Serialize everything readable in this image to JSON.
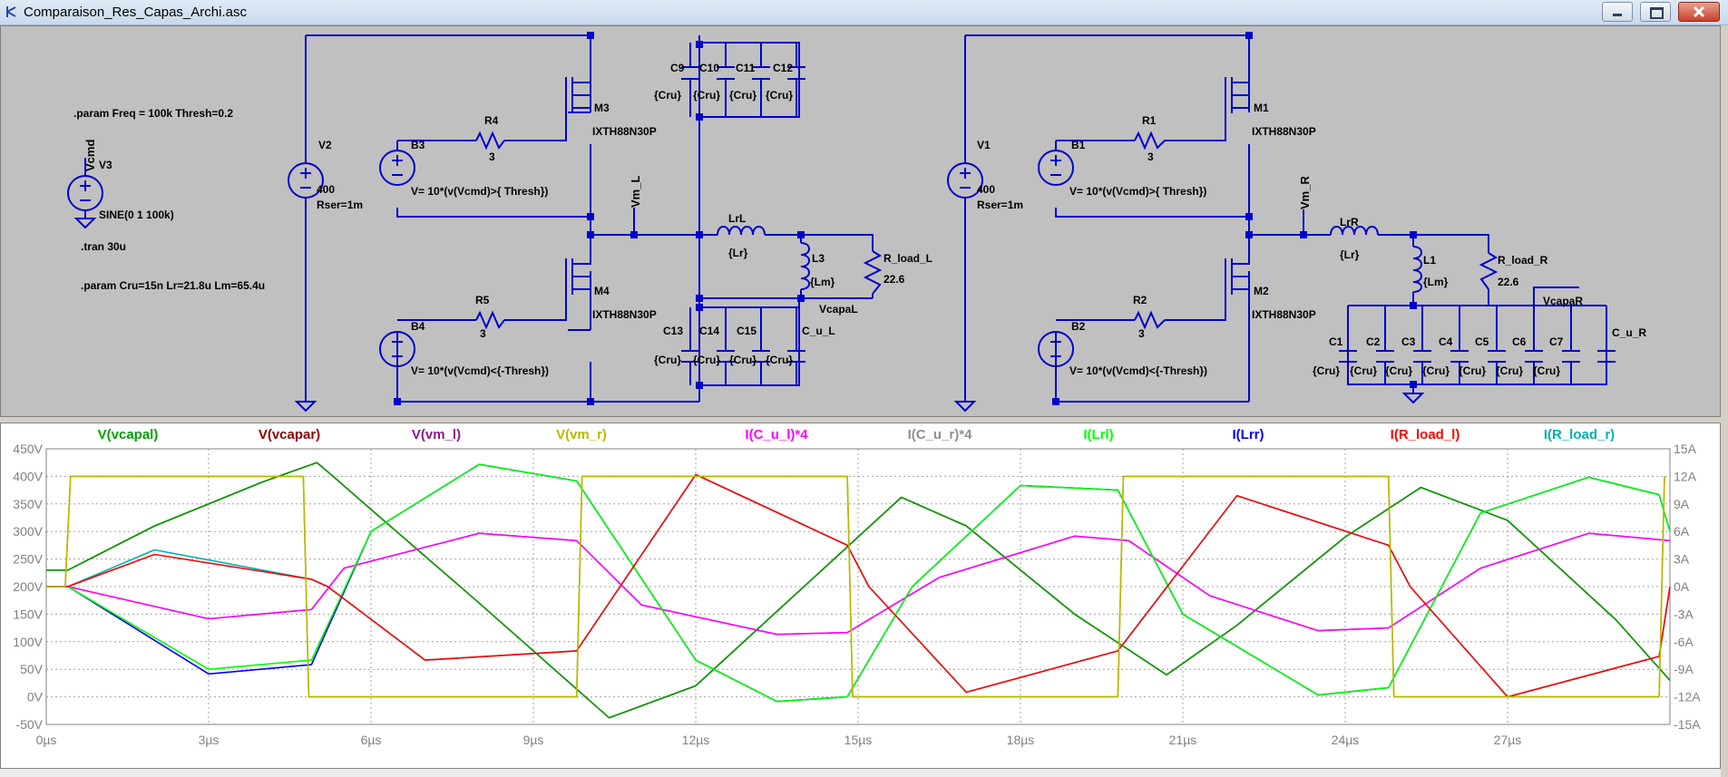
{
  "window": {
    "title": "Comparaison_Res_Capas_Archi.asc",
    "buttons": [
      "minimize",
      "maximize",
      "close"
    ]
  },
  "schematic": {
    "directives": [
      ".param Freq = 100k Thresh=0.2",
      ".tran 30u",
      ".param Cru=15n Lr=21.8u Lm=65.4u"
    ],
    "sources": {
      "v3_name": "V3",
      "v3_value": "SINE(0 1 100k)",
      "v3_net": "Vcmd",
      "v2_name": "V2",
      "v2_value": "400",
      "v2_rser": "Rser=1m",
      "v1_name": "V1",
      "v1_value": "400",
      "v1_rser": "Rser=1m",
      "b3_name": "B3",
      "b3_expr": "V= 10*(v(Vcmd)>{ Thresh})",
      "b4_name": "B4",
      "b4_expr": "V= 10*(v(Vcmd)<{-Thresh})",
      "b1_name": "B1",
      "b1_expr": "V= 10*(v(Vcmd)>{ Thresh})",
      "b2_name": "B2",
      "b2_expr": "V= 10*(v(Vcmd)<{-Thresh})"
    },
    "resistors": {
      "r4_name": "R4",
      "r4_value": "3",
      "r5_name": "R5",
      "r5_value": "3",
      "r1_name": "R1",
      "r1_value": "3",
      "r2_name": "R2",
      "r2_value": "3",
      "rl_name": "R_load_L",
      "rl_value": "22.6",
      "rr_name": "R_load_R",
      "rr_value": "22.6"
    },
    "mosfets": {
      "m3": "M3",
      "m4": "M4",
      "m1": "M1",
      "m2": "M2",
      "part": "IXTH88N30P"
    },
    "inductors": {
      "lrl_name": "LrL",
      "lrl_value": "{Lr}",
      "l3_name": "L3",
      "l3_value": "{Lm}",
      "lrr_name": "LrR",
      "lrr_value": "{Lr}",
      "l1_name": "L1",
      "l1_value": "{Lm}"
    },
    "capacitors": {
      "left_top": [
        "C9",
        "C10",
        "C11",
        "C12"
      ],
      "left_bottom": [
        "C13",
        "C14",
        "C15"
      ],
      "left_bottom_extra": "C_u_L",
      "right_bottom": [
        "C1",
        "C2",
        "C3",
        "C4",
        "C5",
        "C6",
        "C7"
      ],
      "right_bottom_extra": "C_u_R",
      "value": "{Cru}"
    },
    "nets": {
      "vm_l": "Vm_L",
      "vm_r": "Vm_R",
      "vcapa_l": "VcapaL",
      "vcapa_r": "VcapaR"
    }
  },
  "plot": {
    "colors": {
      "vcapal": "#00a000",
      "vcapar": "#900000",
      "vm_l": "#8a1a8a",
      "vm_r": "#b8b800",
      "i_cul": "#ff00ff",
      "i_cur": "#909090",
      "i_lrl": "#00ff00",
      "i_lrr": "#0000ff",
      "i_rll": "#ff0000",
      "i_rlr": "#00b0b0"
    },
    "legend": [
      "V(vcapal)",
      "V(vcapar)",
      "V(vm_l)",
      "V(vm_r)",
      "I(C_u_l)*4",
      "I(C_u_r)*4",
      "I(Lrl)",
      "I(Lrr)",
      "I(R_load_l)",
      "I(R_load_r)"
    ],
    "y_left_ticks": [
      "450V",
      "400V",
      "350V",
      "300V",
      "250V",
      "200V",
      "150V",
      "100V",
      "50V",
      "0V",
      "-50V"
    ],
    "y_right_ticks": [
      "15A",
      "12A",
      "9A",
      "6A",
      "3A",
      "0A",
      "-3A",
      "-6A",
      "-9A",
      "-12A",
      "-15A"
    ],
    "x_ticks": [
      "0µs",
      "3µs",
      "6µs",
      "9µs",
      "12µs",
      "15µs",
      "18µs",
      "21µs",
      "24µs",
      "27µs"
    ]
  },
  "chart_data": {
    "type": "line",
    "xlabel": "",
    "x_unit": "µs",
    "xlim": [
      0,
      30
    ],
    "ylim_left": [
      -50,
      450
    ],
    "ylim_right": [
      -15,
      15
    ],
    "series": [
      {
        "name": "V(vm_r)",
        "x": [
          0,
          0.35,
          0.45,
          4.75,
          4.85,
          5.3,
          9.8,
          9.9,
          14.8,
          14.9,
          19.8,
          19.9,
          24.8,
          24.9,
          29.8,
          29.9
        ],
        "values": [
          200,
          200,
          400,
          400,
          0,
          0,
          0,
          400,
          400,
          0,
          0,
          400,
          400,
          0,
          0,
          400
        ]
      },
      {
        "name": "V(vcapar)",
        "x": [
          0,
          0.4,
          2,
          4,
          5,
          5.3,
          6,
          8,
          10.4,
          12,
          14,
          15.8,
          17,
          19,
          20.7,
          22,
          24,
          25.4,
          27,
          29,
          30
        ],
        "values": [
          230,
          230,
          310,
          390,
          425,
          400,
          340,
          170,
          -38,
          20,
          200,
          362,
          310,
          150,
          40,
          130,
          290,
          380,
          320,
          140,
          30
        ]
      },
      {
        "name": "V(vcapal)",
        "x": [
          0,
          0.4,
          2,
          4,
          5,
          5.3,
          6,
          8,
          10.4,
          12,
          14,
          15.8,
          17,
          19,
          20.7,
          22,
          24,
          25.4,
          27,
          29,
          30
        ],
        "values": [
          230,
          230,
          310,
          390,
          425,
          400,
          340,
          170,
          -38,
          20,
          200,
          362,
          310,
          150,
          40,
          130,
          290,
          380,
          320,
          140,
          30
        ]
      },
      {
        "name": "I(Lrr)",
        "x": [
          0,
          0.4,
          3,
          4.9,
          6,
          8,
          9.8,
          12,
          13.5,
          14.8,
          16,
          18,
          19.8,
          21,
          23.5,
          24.8,
          26.5,
          28.5,
          29.8,
          30
        ],
        "values": [
          0,
          0,
          -9.5,
          -8.5,
          6,
          13.3,
          11.5,
          -8,
          -12.5,
          -12,
          0,
          11,
          10.5,
          -3,
          -11.8,
          -11,
          8,
          11.9,
          10,
          6
        ]
      },
      {
        "name": "I(R_load_r)",
        "x": [
          0,
          0.4,
          2,
          4.9,
          5.2,
          7,
          9.8,
          12,
          14.8,
          15.2,
          17,
          19.8,
          22,
          24.8,
          25.2,
          27,
          29.8,
          30
        ],
        "values": [
          0,
          0,
          4,
          0.8,
          0,
          -8,
          -7,
          12.2,
          4.5,
          0,
          -11.5,
          -7,
          9.9,
          4.5,
          0,
          -12,
          -7.6,
          0
        ]
      },
      {
        "name": "I(C_u_r)*4",
        "x": [
          0,
          0.4,
          3,
          4.9,
          5.5,
          8,
          9.8,
          11,
          13.5,
          14.8,
          16.5,
          19,
          20,
          21.5,
          23.5,
          24.8,
          26.5,
          28.5,
          30
        ],
        "values": [
          0,
          0,
          -3.5,
          -2.5,
          2,
          5.8,
          5,
          -2,
          -5.2,
          -5,
          1,
          5.5,
          5,
          -1,
          -4.8,
          -4.5,
          2,
          5.8,
          5
        ]
      },
      {
        "name": "I(C_u_l)*4",
        "x": [
          0,
          0.4,
          3,
          4.9,
          5.5,
          8,
          9.8,
          11,
          13.5,
          14.8,
          16.5,
          19,
          20,
          21.5,
          23.5,
          24.8,
          26.5,
          28.5,
          30
        ],
        "values": [
          0,
          0,
          -3.5,
          -2.5,
          2,
          5.8,
          5,
          -2,
          -5.2,
          -5,
          1,
          5.5,
          5,
          -1,
          -4.8,
          -4.5,
          2,
          5.8,
          5
        ]
      },
      {
        "name": "I(Lrl)",
        "x": [
          0,
          0.4,
          3,
          4.9,
          6,
          8,
          9.8,
          12,
          13.5,
          14.8,
          16,
          18,
          19.8,
          21,
          23.5,
          24.8,
          26.5,
          28.5,
          29.8,
          30
        ],
        "values": [
          0,
          0,
          -9,
          -8,
          6,
          13.3,
          11.5,
          -8,
          -12.5,
          -12,
          0,
          11,
          10.5,
          -3,
          -11.8,
          -11,
          8,
          11.9,
          10,
          6
        ]
      },
      {
        "name": "I(R_load_l)",
        "x": [
          0,
          0.4,
          2,
          4.9,
          5.2,
          7,
          9.8,
          12,
          14.8,
          15.2,
          17,
          19.8,
          22,
          24.8,
          25.2,
          27,
          29.8,
          30
        ],
        "values": [
          0,
          0,
          3.5,
          0.8,
          0,
          -8,
          -7,
          12.2,
          4.5,
          0,
          -11.5,
          -7,
          9.9,
          4.5,
          0,
          -12,
          -7.6,
          0
        ]
      },
      {
        "name": "V(vm_l)",
        "x": [
          0,
          0.35,
          0.45,
          4.75,
          4.85,
          5.3,
          9.8,
          9.9,
          14.8,
          14.9,
          19.8,
          19.9,
          24.8,
          24.9,
          29.8,
          29.9
        ],
        "values": [
          200,
          200,
          400,
          400,
          0,
          0,
          0,
          400,
          400,
          0,
          0,
          400,
          400,
          0,
          0,
          400
        ]
      }
    ]
  }
}
